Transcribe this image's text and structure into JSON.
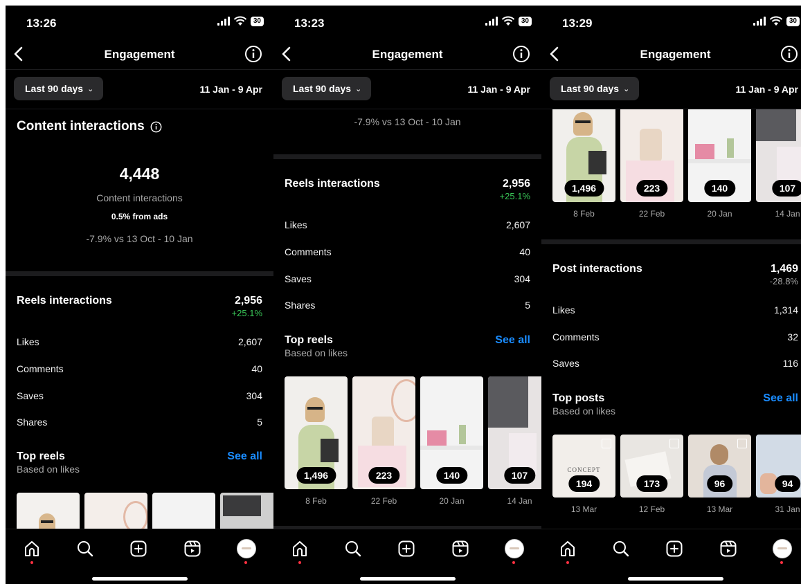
{
  "screens": [
    {
      "status": {
        "time": "13:26",
        "battery": "30"
      },
      "nav": {
        "title": "Engagement"
      },
      "filter": {
        "period": "Last 90 days",
        "range": "11 Jan - 9 Apr"
      },
      "content_interactions": {
        "title": "Content interactions",
        "total": "4,448",
        "total_label": "Content interactions",
        "ads_note": "0.5% from ads",
        "comparison": "-7.9% vs 13 Oct - 10 Jan"
      },
      "reels": {
        "title": "Reels interactions",
        "total": "2,956",
        "change": "+25.1%",
        "rows": [
          {
            "label": "Likes",
            "value": "2,607"
          },
          {
            "label": "Comments",
            "value": "40"
          },
          {
            "label": "Saves",
            "value": "304"
          },
          {
            "label": "Shares",
            "value": "5"
          }
        ]
      },
      "top_reels": {
        "title": "Top reels",
        "subtitle": "Based on likes",
        "see_all": "See all"
      }
    },
    {
      "status": {
        "time": "13:23",
        "battery": "30"
      },
      "nav": {
        "title": "Engagement"
      },
      "filter": {
        "period": "Last 90 days",
        "range": "11 Jan - 9 Apr"
      },
      "comparison": "-7.9% vs 13 Oct - 10 Jan",
      "reels": {
        "title": "Reels interactions",
        "total": "2,956",
        "change": "+25.1%",
        "rows": [
          {
            "label": "Likes",
            "value": "2,607"
          },
          {
            "label": "Comments",
            "value": "40"
          },
          {
            "label": "Saves",
            "value": "304"
          },
          {
            "label": "Shares",
            "value": "5"
          }
        ]
      },
      "top_reels": {
        "title": "Top reels",
        "subtitle": "Based on likes",
        "see_all": "See all",
        "items": [
          {
            "likes": "1,496",
            "date": "8 Feb"
          },
          {
            "likes": "223",
            "date": "22 Feb"
          },
          {
            "likes": "140",
            "date": "20 Jan"
          },
          {
            "likes": "107",
            "date": "14 Jan"
          }
        ]
      }
    },
    {
      "status": {
        "time": "13:29",
        "battery": "30"
      },
      "nav": {
        "title": "Engagement"
      },
      "filter": {
        "period": "Last 90 days",
        "range": "11 Jan - 9 Apr"
      },
      "top_reels": {
        "items": [
          {
            "likes": "1,496",
            "date": "8 Feb"
          },
          {
            "likes": "223",
            "date": "22 Feb"
          },
          {
            "likes": "140",
            "date": "20 Jan"
          },
          {
            "likes": "107",
            "date": "14 Jan"
          }
        ]
      },
      "posts": {
        "title": "Post interactions",
        "total": "1,469",
        "change": "-28.8%",
        "rows": [
          {
            "label": "Likes",
            "value": "1,314"
          },
          {
            "label": "Comments",
            "value": "32"
          },
          {
            "label": "Saves",
            "value": "116"
          }
        ]
      },
      "top_posts": {
        "title": "Top posts",
        "subtitle": "Based on likes",
        "see_all": "See all",
        "items": [
          {
            "likes": "194",
            "date": "13 Mar",
            "caption": "CONCEPT"
          },
          {
            "likes": "173",
            "date": "12 Feb"
          },
          {
            "likes": "96",
            "date": "13 Mar"
          },
          {
            "likes": "94",
            "date": "31 Jan"
          }
        ]
      }
    }
  ],
  "colors": {
    "background": "#000000",
    "accent": "#1a8cff",
    "positive": "#3ac858",
    "notification": "#ff3040"
  }
}
